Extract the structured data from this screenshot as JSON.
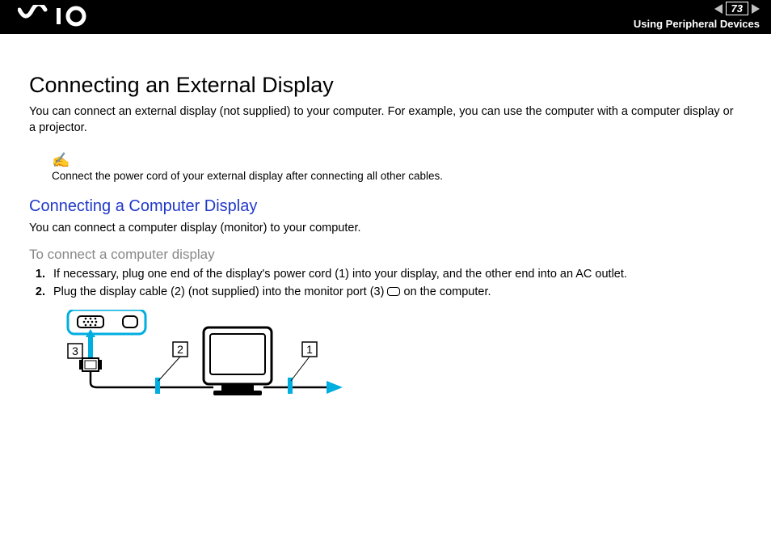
{
  "header": {
    "page_number": "73",
    "section": "Using Peripheral Devices"
  },
  "title": "Connecting an External Display",
  "intro": "You can connect an external display (not supplied) to your computer. For example, you can use the computer with a computer display or a projector.",
  "note": "Connect the power cord of your external display after connecting all other cables.",
  "subheading": "Connecting a Computer Display",
  "subintro": "You can connect a computer display (monitor) to your computer.",
  "procedure_title": "To connect a computer display",
  "steps": [
    "If necessary, plug one end of the display's power cord (1) into your display, and the other end into an AC outlet.",
    "Plug the display cable (2) (not supplied) into the monitor port (3)    on the computer."
  ],
  "diagram": {
    "callouts": [
      "3",
      "2",
      "1"
    ]
  }
}
